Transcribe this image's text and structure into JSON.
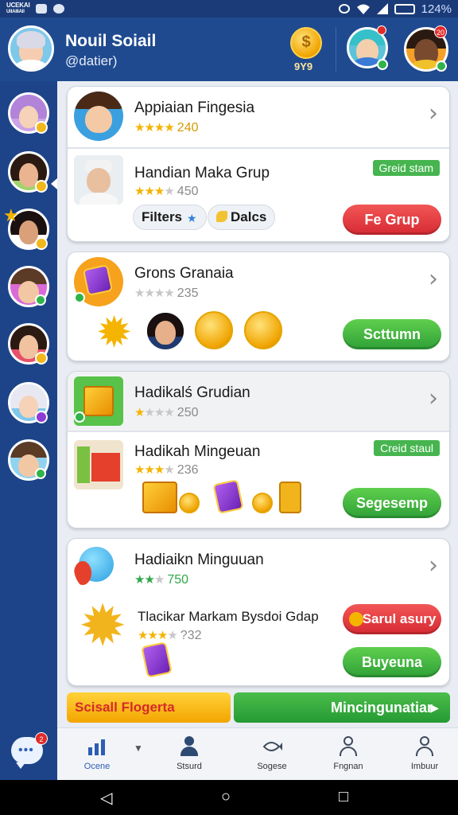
{
  "status_bar": {
    "brand_line1": "UCEKAI",
    "brand_line2": "UIIAIIIAII",
    "battery_text": "124%"
  },
  "header": {
    "name": "Nouil Soiail",
    "handle": "@datier)",
    "coin_count": "9Y9",
    "friend1_badge": "",
    "friend2_badge": "20"
  },
  "sidebar": {
    "chat_badge": "2"
  },
  "cards": [
    {
      "rows": [
        {
          "title": "Appiaian Fingesia",
          "rating": "240",
          "stars_filled": 4
        },
        {
          "title": "Handian Maka Grup",
          "rating": "450",
          "stars_filled": 3,
          "tag": "Greid stam",
          "chips": [
            {
              "label": "Filters",
              "icon": "star-icon"
            },
            {
              "label": "Dalcs",
              "icon": "banana-icon"
            }
          ],
          "button": "Fe Grup"
        }
      ]
    },
    {
      "rows": [
        {
          "title": "Grons Granaia",
          "rating": "235",
          "stars_filled": 0,
          "button": "Scttumn"
        }
      ]
    },
    {
      "rows": [
        {
          "title": "Hadikalś Grudian",
          "rating": "250",
          "stars_filled": 1
        },
        {
          "title": "Hadikah Mingeuan",
          "rating": "236",
          "stars_filled": 3,
          "tag": "Creid staul",
          "button": "Segesemp"
        }
      ]
    },
    {
      "rows": [
        {
          "title": "Hadiaikn Minguuan",
          "rating": "750",
          "stars_filled": 2
        },
        {
          "title": "Tlacikar Markam Bysdoi Gdap",
          "rating": "?32",
          "stars_filled": 3,
          "button_top": "Sarul asury",
          "button_bottom": "Buyeuna"
        }
      ]
    }
  ],
  "banner": {
    "left": "Scisall Flogerta",
    "right": "Mincingunatiar"
  },
  "tabs": [
    {
      "label": "Ocene",
      "icon": "chart-icon"
    },
    {
      "label": "Stsurd",
      "icon": "person-icon"
    },
    {
      "label": "Sogese",
      "icon": "fish-icon"
    },
    {
      "label": "Fngnan",
      "icon": "person-outline-icon"
    },
    {
      "label": "Imbuur",
      "icon": "person-outline-icon"
    }
  ],
  "colors": {
    "brand_blue": "#1f4a90",
    "accent_green": "#2fa037",
    "accent_red": "#d62a33",
    "gold": "#f4b400"
  }
}
